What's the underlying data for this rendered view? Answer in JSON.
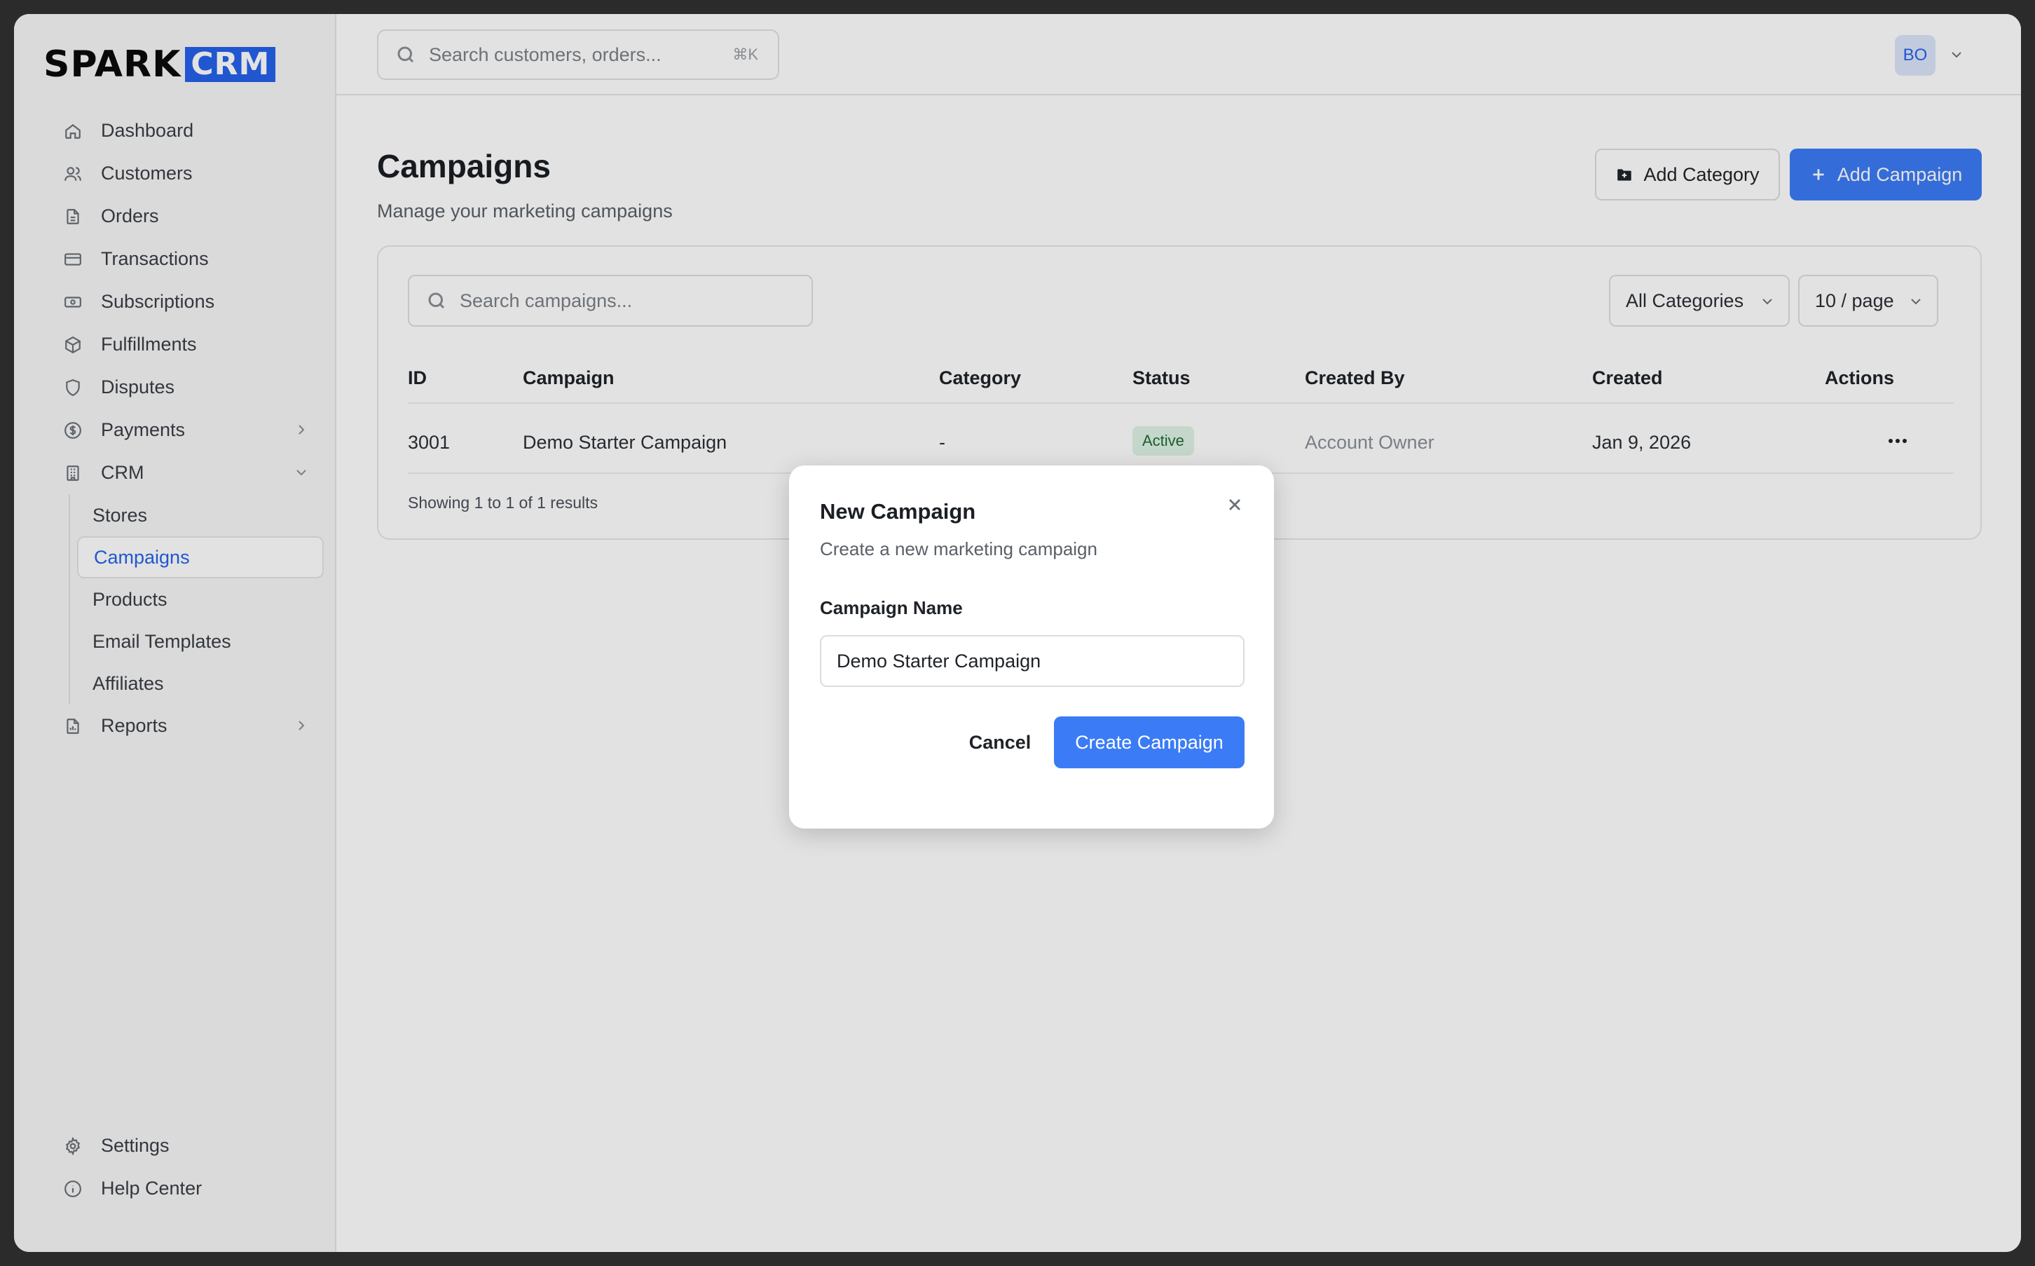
{
  "brand": {
    "part1": "SPARK",
    "part2": "CRM",
    "accent": "#2563eb"
  },
  "sidebar": {
    "items": [
      {
        "label": "Dashboard",
        "icon": "home-icon"
      },
      {
        "label": "Customers",
        "icon": "users-icon"
      },
      {
        "label": "Orders",
        "icon": "file-icon"
      },
      {
        "label": "Transactions",
        "icon": "credit-card-icon"
      },
      {
        "label": "Subscriptions",
        "icon": "banknote-icon"
      },
      {
        "label": "Fulfillments",
        "icon": "package-icon"
      },
      {
        "label": "Disputes",
        "icon": "shield-icon"
      },
      {
        "label": "Payments",
        "icon": "dollar-circle-icon"
      },
      {
        "label": "CRM",
        "icon": "building-icon"
      },
      {
        "label": "Reports",
        "icon": "report-icon"
      }
    ],
    "crm_sub": [
      "Stores",
      "Campaigns",
      "Products",
      "Email Templates",
      "Affiliates"
    ],
    "bottom": [
      {
        "label": "Settings",
        "icon": "gear-icon"
      },
      {
        "label": "Help Center",
        "icon": "info-icon"
      }
    ]
  },
  "topbar": {
    "search_placeholder": "Search customers, orders...",
    "shortcut": "⌘K",
    "avatar_initials": "BO"
  },
  "page": {
    "title": "Campaigns",
    "subtitle": "Manage your marketing campaigns",
    "add_category": "Add Category",
    "add_campaign": "Add Campaign"
  },
  "table": {
    "search_placeholder": "Search campaigns...",
    "category_filter": "All Categories",
    "page_size": "10 / page",
    "headers": [
      "ID",
      "Campaign",
      "Category",
      "Status",
      "Created By",
      "Created",
      "Actions"
    ],
    "rows": [
      {
        "id": "3001",
        "campaign": "Demo Starter Campaign",
        "category": "-",
        "status": "Active",
        "created_by": "Account Owner",
        "created": "Jan 9, 2026"
      }
    ],
    "showing": "Showing 1 to 1 of 1 results"
  },
  "modal": {
    "title": "New Campaign",
    "subtitle": "Create a new marketing campaign",
    "field_label": "Campaign Name",
    "field_value": "Demo Starter Campaign",
    "cancel": "Cancel",
    "create": "Create Campaign"
  }
}
